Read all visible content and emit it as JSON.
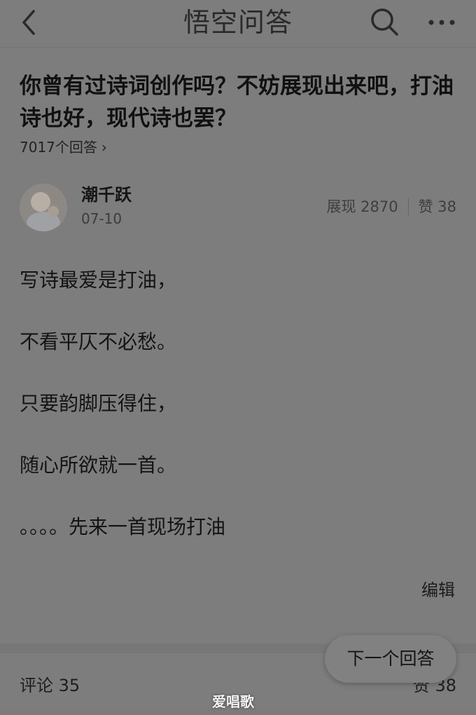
{
  "header": {
    "app_title": "悟空问答",
    "back_icon": "chevron-left-icon",
    "search_icon": "search-icon",
    "more_icon": "more-horizontal-icon"
  },
  "question": {
    "title": "你曾有过诗词创作吗？不妨展现出来吧，打油诗也好，现代诗也罢？",
    "answer_count": "7017个回答",
    "chevron_icon": "chevron-right-icon"
  },
  "answer": {
    "author": "潮千跃",
    "date": "07-10",
    "views": "展现 2870",
    "likes": "赞 38",
    "lines": [
      "写诗最爱是打油，",
      "不看平仄不必愁。",
      "只要韵脚压得住，",
      "随心所欲就一首。",
      "。。。。先来一首现场打油"
    ],
    "edit_label": "编辑"
  },
  "footer": {
    "next_answer": "下一个回答",
    "comments": "评论 35",
    "likes": "赞 38",
    "watermark": "爱唱歌"
  },
  "colors": {
    "overlay_background": "#7d7d7d",
    "text": "#141414"
  }
}
